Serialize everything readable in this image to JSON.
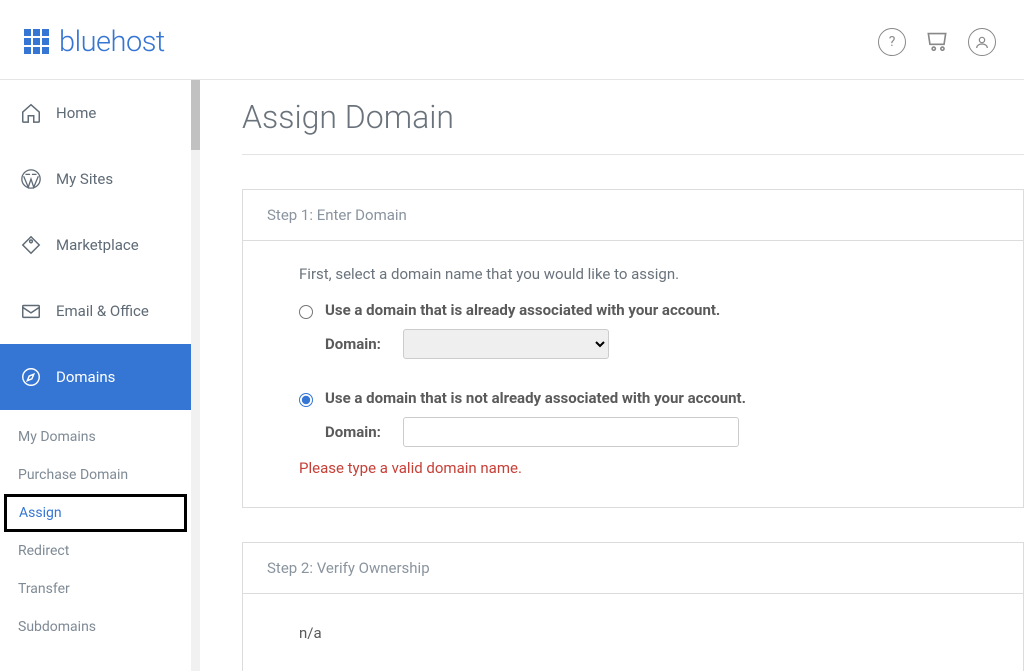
{
  "brand": "bluehost",
  "nav": {
    "home": "Home",
    "mysites": "My Sites",
    "marketplace": "Marketplace",
    "email": "Email & Office",
    "domains": "Domains"
  },
  "subnav": {
    "mydomains": "My Domains",
    "purchase": "Purchase Domain",
    "assign": "Assign",
    "redirect": "Redirect",
    "transfer": "Transfer",
    "subdomains": "Subdomains"
  },
  "page": {
    "title": "Assign Domain"
  },
  "step1": {
    "heading": "Step 1: Enter Domain",
    "intro": "First, select a domain name that you would like to assign.",
    "option_associated": "Use a domain that is already associated with your account.",
    "option_not_associated": "Use a domain that is not already associated with your account.",
    "domain_label": "Domain:",
    "error": "Please type a valid domain name."
  },
  "step2": {
    "heading": "Step 2: Verify Ownership",
    "content": "n/a"
  }
}
